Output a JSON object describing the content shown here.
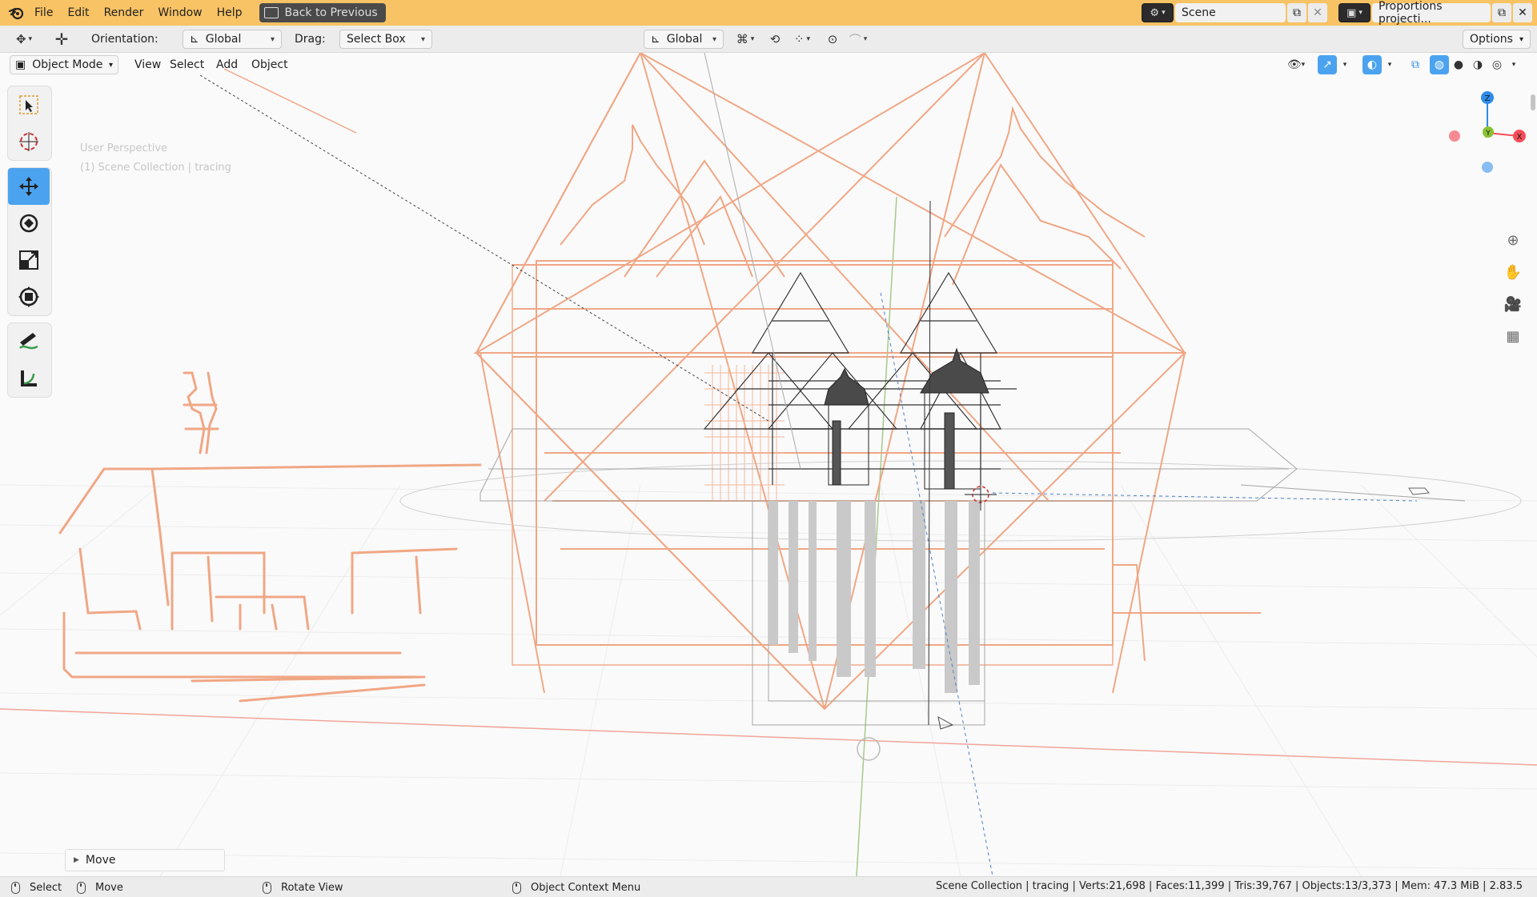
{
  "topbar": {
    "logo_icon": "blender-logo-icon",
    "menu": [
      "File",
      "Edit",
      "Render",
      "Window",
      "Help"
    ],
    "back_button": "Back to Previous",
    "scene_name": "Scene",
    "view_layer_name": "Proportions projecti...",
    "accent_color": "#f8c365"
  },
  "toolbar": {
    "orientation_label": "Orientation:",
    "orientation_value": "Global",
    "drag_label": "Drag:",
    "drag_value": "Select Box",
    "transform_orientation": "Global",
    "options_label": "Options"
  },
  "viewport_header": {
    "mode": "Object Mode",
    "menus": [
      "View",
      "Select",
      "Add",
      "Object"
    ]
  },
  "viewport": {
    "overlay_line1": "User Perspective",
    "overlay_line2": "(1) Scene Collection | tracing",
    "gizmo_axes": {
      "z": "Z",
      "y": "Y",
      "x": "X"
    },
    "axis_colors": {
      "x": "#f44d58",
      "y": "#8ac234",
      "z": "#2d8ceb"
    }
  },
  "tools": [
    {
      "name": "select-box-tool",
      "icon": "cursor-select-icon"
    },
    {
      "name": "cursor-tool",
      "icon": "3d-cursor-icon"
    },
    {
      "name": "move-tool",
      "icon": "move-arrows-icon",
      "active": true
    },
    {
      "name": "rotate-tool",
      "icon": "rotate-icon"
    },
    {
      "name": "scale-tool",
      "icon": "scale-icon"
    },
    {
      "name": "transform-tool",
      "icon": "transform-icon"
    },
    {
      "name": "annotate-tool",
      "icon": "annotate-pencil-icon"
    },
    {
      "name": "measure-tool",
      "icon": "measure-ruler-icon"
    }
  ],
  "last_operation": "Move",
  "statusbar": {
    "select": "Select",
    "move": "Move",
    "rotate_view": "Rotate View",
    "context_menu": "Object Context Menu",
    "stats": "Scene Collection | tracing | Verts:21,698 | Faces:11,399 | Tris:39,767 | Objects:13/3,373 | Mem: 47.3 MiB | 2.83.5"
  }
}
